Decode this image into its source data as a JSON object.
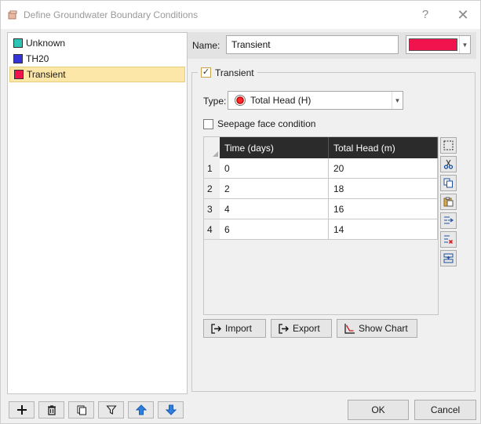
{
  "window": {
    "title": "Define Groundwater Boundary Conditions",
    "help_glyph": "?",
    "close_glyph": "✕"
  },
  "boundary_list": {
    "items": [
      {
        "label": "Unknown",
        "color": "#2ec4b6",
        "selected": false
      },
      {
        "label": "TH20",
        "color": "#3434d8",
        "selected": false
      },
      {
        "label": "Transient",
        "color": "#f0134d",
        "selected": true
      }
    ]
  },
  "list_toolbar": {
    "icons": [
      "add-icon",
      "delete-icon",
      "copy-icon",
      "filter-icon",
      "move-up-icon",
      "move-down-icon"
    ]
  },
  "properties": {
    "name_label": "Name:",
    "name_value": "Transient",
    "color_value": "#f0134d",
    "transient_label": "Transient",
    "transient_checked": true,
    "type_label": "Type:",
    "type_value": "Total Head (H)",
    "seepage_label": "Seepage face condition",
    "seepage_checked": false
  },
  "table": {
    "columns": [
      "Time (days)",
      "Total Head (m)"
    ],
    "rows": [
      {
        "num": "1",
        "time": "0",
        "head": "20"
      },
      {
        "num": "2",
        "time": "2",
        "head": "18"
      },
      {
        "num": "3",
        "time": "4",
        "head": "16"
      },
      {
        "num": "4",
        "time": "6",
        "head": "14"
      }
    ]
  },
  "table_tools": [
    "select-all-icon",
    "cut-icon",
    "copy-icon",
    "paste-icon",
    "insert-row-icon",
    "delete-row-icon",
    "append-row-icon"
  ],
  "actions": {
    "import_label": "Import",
    "export_label": "Export",
    "show_chart_label": "Show Chart"
  },
  "dialog": {
    "ok_label": "OK",
    "cancel_label": "Cancel"
  }
}
